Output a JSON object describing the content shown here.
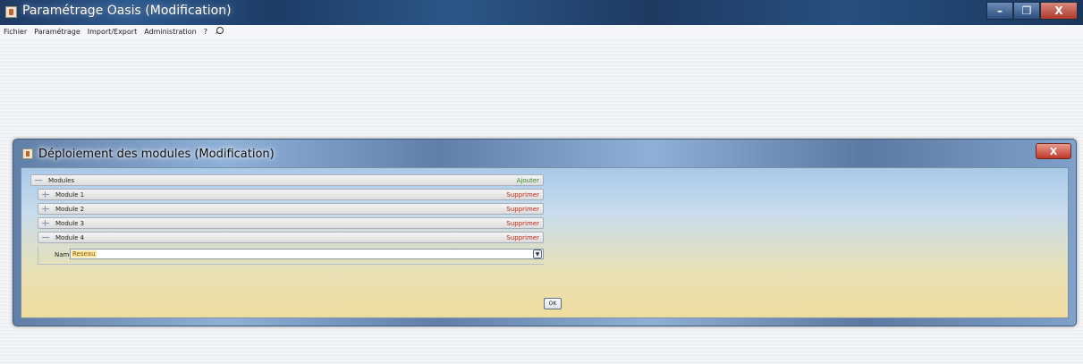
{
  "main_window": {
    "title": "Paramétrage Oasis (Modification)",
    "minimize": "–",
    "maximize": "❐",
    "close": "X"
  },
  "menubar": {
    "items": [
      "Fichier",
      "Paramétrage",
      "Import/Export",
      "Administration",
      "?"
    ]
  },
  "dialog": {
    "title": "Déploiement des modules (Modification)",
    "close": "X",
    "tree": {
      "root_label": "Modules",
      "root_action": "Ajouter",
      "modules": [
        {
          "label": "Module 1",
          "action": "Supprimer"
        },
        {
          "label": "Module 2",
          "action": "Supprimer"
        },
        {
          "label": "Module 3",
          "action": "Supprimer"
        },
        {
          "label": "Module 4",
          "action": "Supprimer"
        }
      ],
      "name_label": "Name",
      "name_value": "Reseau"
    },
    "ok_label": "OK"
  },
  "colors": {
    "add_action": "#3c8a2a",
    "delete_action": "#c0271b"
  }
}
